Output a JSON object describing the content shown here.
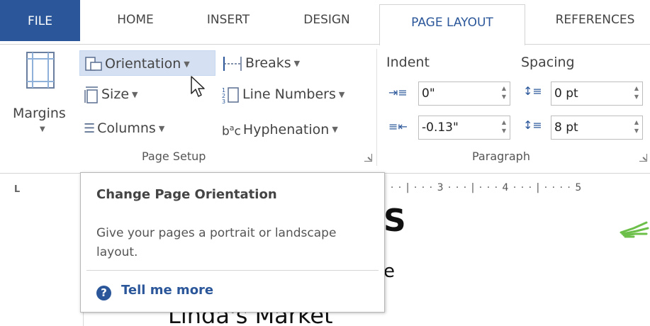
{
  "tabs": [
    {
      "label": "FILE"
    },
    {
      "label": "HOME"
    },
    {
      "label": "INSERT"
    },
    {
      "label": "DESIGN"
    },
    {
      "label": "PAGE LAYOUT"
    },
    {
      "label": "REFERENCES"
    }
  ],
  "active_tab": "PAGE LAYOUT",
  "page_setup": {
    "group_label": "Page Setup",
    "margins_label": "Margins",
    "orientation_label": "Orientation",
    "size_label": "Size",
    "columns_label": "Columns",
    "breaks_label": "Breaks",
    "line_numbers_label": "Line Numbers",
    "hyphenation_label": "Hyphenation"
  },
  "paragraph": {
    "group_label": "Paragraph",
    "indent_label": "Indent",
    "spacing_label": "Spacing",
    "indent_left_value": "0\"",
    "indent_right_value": "-0.13\"",
    "spacing_before_value": "0 pt",
    "spacing_after_value": "8 pt"
  },
  "ruler": {
    "corner_symbol": "L",
    "marks": "· · · | · · · 3 · · · | · · · 4 · · · | · · · · 5"
  },
  "document": {
    "heading_fragment": "S",
    "line_fragment": "e",
    "market_text": "Linda's Market"
  },
  "tooltip": {
    "title": "Change Page Orientation",
    "description": "Give your pages a portrait or landscape layout.",
    "help_link": "Tell me more",
    "help_icon": "?"
  },
  "colors": {
    "file_tab_bg": "#2b579a",
    "accent": "#2b579a",
    "hover_highlight": "#d5e1f2"
  }
}
